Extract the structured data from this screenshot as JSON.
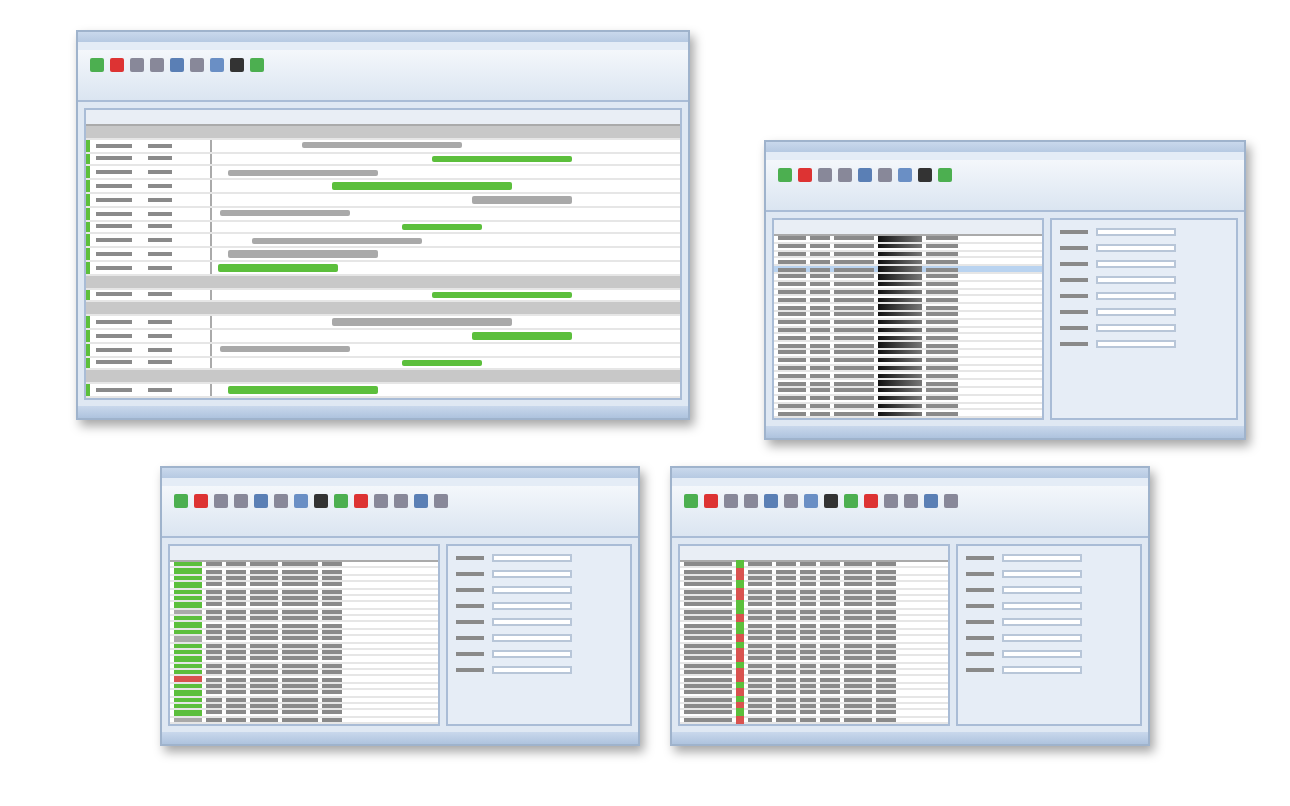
{
  "screens": [
    {
      "kind": "gantt",
      "rows": [
        {
          "kind": "group"
        },
        {
          "kind": "item",
          "color": "#a9a9a9"
        },
        {
          "kind": "item",
          "color": "#5cbf3c"
        },
        {
          "kind": "item",
          "color": "#a9a9a9"
        },
        {
          "kind": "item",
          "color": "#5cbf3c"
        },
        {
          "kind": "item",
          "color": "#a9a9a9"
        },
        {
          "kind": "item",
          "color": "#a9a9a9"
        },
        {
          "kind": "item",
          "color": "#5cbf3c"
        },
        {
          "kind": "item",
          "color": "#a9a9a9"
        },
        {
          "kind": "item",
          "color": "#a9a9a9"
        },
        {
          "kind": "item",
          "color": "#5cbf3c"
        },
        {
          "kind": "group"
        },
        {
          "kind": "item",
          "color": "#5cbf3c"
        },
        {
          "kind": "group"
        },
        {
          "kind": "item",
          "color": "#a9a9a9"
        },
        {
          "kind": "item",
          "color": "#5cbf3c"
        },
        {
          "kind": "item",
          "color": "#a9a9a9"
        },
        {
          "kind": "item",
          "color": "#5cbf3c"
        },
        {
          "kind": "group"
        },
        {
          "kind": "item",
          "color": "#5cbf3c"
        }
      ]
    },
    {
      "kind": "grid",
      "rows": [
        {
          "selected": false
        },
        {
          "selected": false
        },
        {
          "selected": false
        },
        {
          "selected": false
        },
        {
          "selected": true
        },
        {
          "selected": false
        },
        {
          "selected": false
        },
        {
          "selected": false
        },
        {
          "selected": false
        },
        {
          "selected": false
        },
        {
          "selected": false
        },
        {
          "selected": false
        },
        {
          "selected": false
        },
        {
          "selected": false
        },
        {
          "selected": false
        },
        {
          "selected": false
        },
        {
          "selected": false
        },
        {
          "selected": false
        },
        {
          "selected": false
        },
        {
          "selected": false
        },
        {
          "selected": false
        },
        {
          "selected": false
        },
        {
          "selected": false
        },
        {
          "selected": false
        }
      ]
    },
    {
      "kind": "status",
      "rows": [
        {
          "color": "#5cbf3c"
        },
        {
          "color": "#5cbf3c"
        },
        {
          "color": "#5cbf3c"
        },
        {
          "color": "#5cbf3c"
        },
        {
          "color": "#5cbf3c"
        },
        {
          "color": "#5cbf3c"
        },
        {
          "color": "#5cbf3c"
        },
        {
          "color": "#a9a9a9"
        },
        {
          "color": "#5cbf3c"
        },
        {
          "color": "#5cbf3c"
        },
        {
          "color": "#5cbf3c"
        },
        {
          "color": "#a9a9a9"
        },
        {
          "color": "#5cbf3c"
        },
        {
          "color": "#5cbf3c"
        },
        {
          "color": "#5cbf3c"
        },
        {
          "color": "#5cbf3c"
        },
        {
          "color": "#5cbf3c"
        },
        {
          "color": "#d9534f"
        },
        {
          "color": "#5cbf3c"
        },
        {
          "color": "#5cbf3c"
        },
        {
          "color": "#5cbf3c"
        },
        {
          "color": "#5cbf3c"
        },
        {
          "color": "#5cbf3c"
        },
        {
          "color": "#a9a9a9"
        }
      ]
    },
    {
      "kind": "check",
      "rows": [
        {
          "color": "#5cbf3c"
        },
        {
          "color": "#d9534f"
        },
        {
          "color": "#d9534f"
        },
        {
          "color": "#5cbf3c"
        },
        {
          "color": "#d9534f"
        },
        {
          "color": "#d9534f"
        },
        {
          "color": "#5cbf3c"
        },
        {
          "color": "#5cbf3c"
        },
        {
          "color": "#d9534f"
        },
        {
          "color": "#5cbf3c"
        },
        {
          "color": "#5cbf3c"
        },
        {
          "color": "#d9534f"
        },
        {
          "color": "#5cbf3c"
        },
        {
          "color": "#d9534f"
        },
        {
          "color": "#d9534f"
        },
        {
          "color": "#5cbf3c"
        },
        {
          "color": "#d9534f"
        },
        {
          "color": "#d9534f"
        },
        {
          "color": "#5cbf3c"
        },
        {
          "color": "#d9534f"
        },
        {
          "color": "#5cbf3c"
        },
        {
          "color": "#d9534f"
        },
        {
          "color": "#5cbf3c"
        },
        {
          "color": "#d9534f"
        }
      ]
    }
  ]
}
